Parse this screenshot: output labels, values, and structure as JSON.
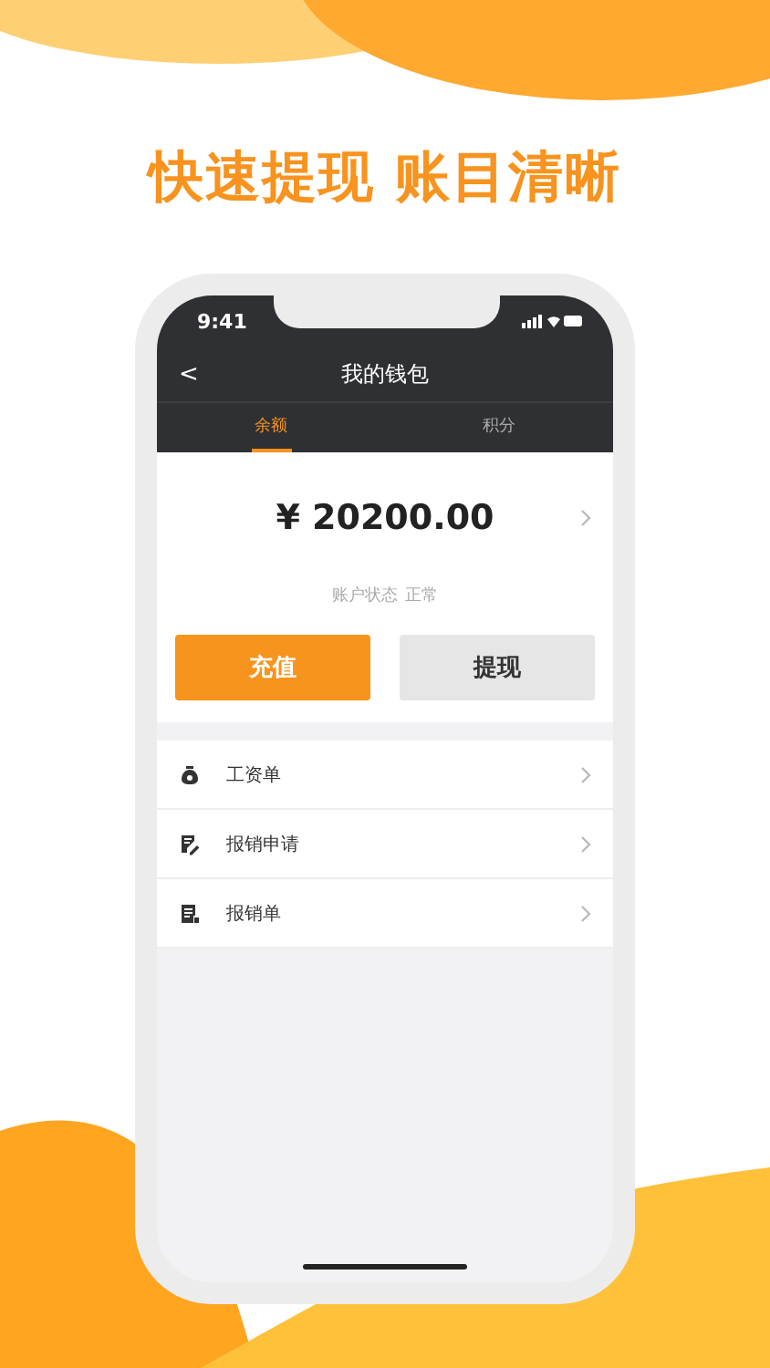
{
  "headline": "快速提现 账目清晰",
  "status_bar": {
    "time": "9:41"
  },
  "nav": {
    "back": "<",
    "title": "我的钱包"
  },
  "tabs": [
    {
      "label": "余额",
      "selected": true
    },
    {
      "label": "积分",
      "selected": false
    }
  ],
  "balance": {
    "amount": "¥ 20200.00",
    "status_label": "账户状态",
    "status_value": "正常"
  },
  "buttons": [
    {
      "label": "充值",
      "kind": "primary"
    },
    {
      "label": "提现",
      "kind": "secondary"
    }
  ],
  "menu": [
    {
      "label": "工资单"
    },
    {
      "label": "报销申请"
    },
    {
      "label": "报销单"
    }
  ]
}
